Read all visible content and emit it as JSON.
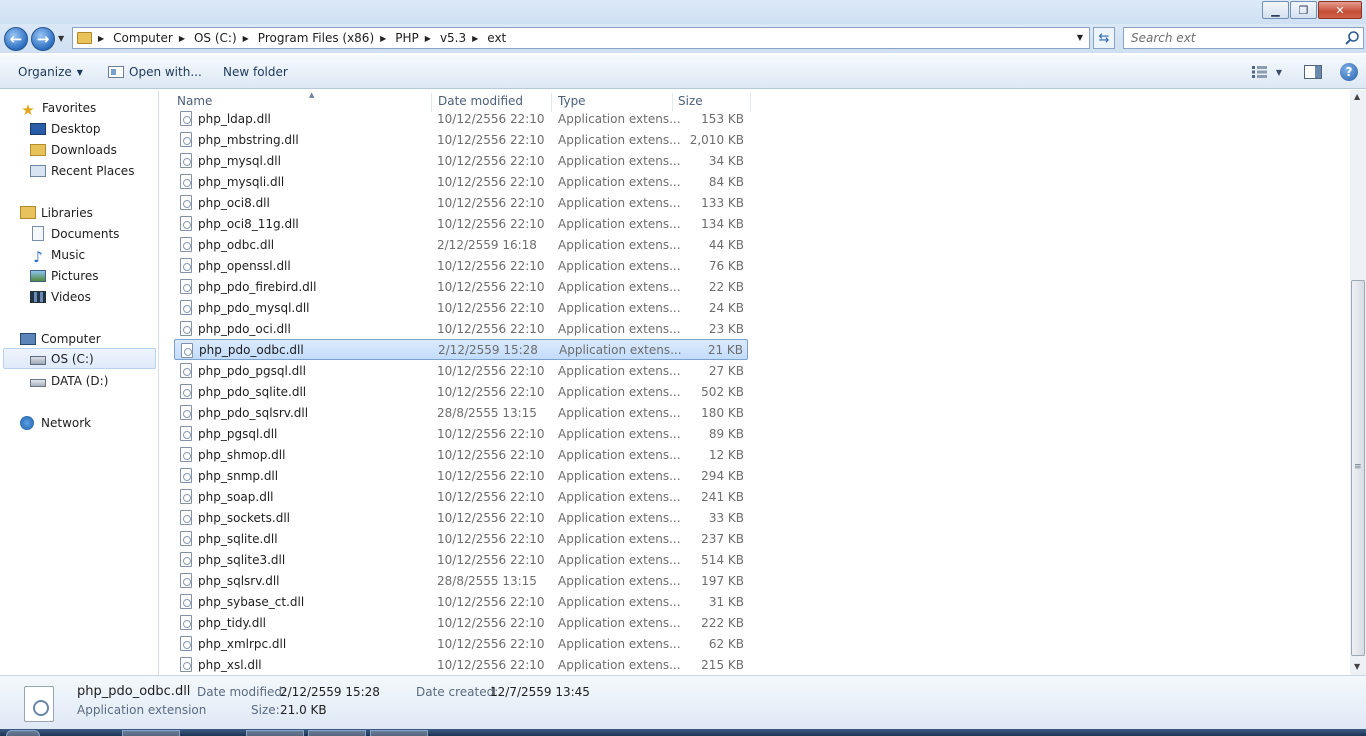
{
  "window": {
    "minimize_glyph": "▁",
    "restore_glyph": "❐",
    "close_glyph": "✕"
  },
  "nav": {
    "back_glyph": "←",
    "forward_glyph": "→",
    "breadcrumb": [
      "Computer",
      "OS (C:)",
      "Program Files (x86)",
      "PHP",
      "v5.3",
      "ext"
    ],
    "search_placeholder": "Search ext"
  },
  "toolbar": {
    "organize_label": "Organize",
    "open_with_label": "Open with...",
    "new_folder_label": "New folder",
    "help_glyph": "?"
  },
  "sidebar": {
    "favorites_label": "Favorites",
    "desktop_label": "Desktop",
    "downloads_label": "Downloads",
    "recent_label": "Recent Places",
    "libraries_label": "Libraries",
    "documents_label": "Documents",
    "music_label": "Music",
    "pictures_label": "Pictures",
    "videos_label": "Videos",
    "computer_label": "Computer",
    "drive_c_label": "OS (C:)",
    "drive_d_label": "DATA (D:)",
    "network_label": "Network"
  },
  "columns": {
    "name": "Name",
    "date": "Date modified",
    "type": "Type",
    "size": "Size"
  },
  "files": [
    {
      "name": "php_ldap.dll",
      "date": "10/12/2556 22:10",
      "type": "Application extens...",
      "size": "153 KB"
    },
    {
      "name": "php_mbstring.dll",
      "date": "10/12/2556 22:10",
      "type": "Application extens...",
      "size": "2,010 KB"
    },
    {
      "name": "php_mysql.dll",
      "date": "10/12/2556 22:10",
      "type": "Application extens...",
      "size": "34 KB"
    },
    {
      "name": "php_mysqli.dll",
      "date": "10/12/2556 22:10",
      "type": "Application extens...",
      "size": "84 KB"
    },
    {
      "name": "php_oci8.dll",
      "date": "10/12/2556 22:10",
      "type": "Application extens...",
      "size": "133 KB"
    },
    {
      "name": "php_oci8_11g.dll",
      "date": "10/12/2556 22:10",
      "type": "Application extens...",
      "size": "134 KB"
    },
    {
      "name": "php_odbc.dll",
      "date": "2/12/2559 16:18",
      "type": "Application extens...",
      "size": "44 KB"
    },
    {
      "name": "php_openssl.dll",
      "date": "10/12/2556 22:10",
      "type": "Application extens...",
      "size": "76 KB"
    },
    {
      "name": "php_pdo_firebird.dll",
      "date": "10/12/2556 22:10",
      "type": "Application extens...",
      "size": "22 KB"
    },
    {
      "name": "php_pdo_mysql.dll",
      "date": "10/12/2556 22:10",
      "type": "Application extens...",
      "size": "24 KB"
    },
    {
      "name": "php_pdo_oci.dll",
      "date": "10/12/2556 22:10",
      "type": "Application extens...",
      "size": "23 KB"
    },
    {
      "name": "php_pdo_odbc.dll",
      "date": "2/12/2559 15:28",
      "type": "Application extens...",
      "size": "21 KB",
      "selected": true
    },
    {
      "name": "php_pdo_pgsql.dll",
      "date": "10/12/2556 22:10",
      "type": "Application extens...",
      "size": "27 KB"
    },
    {
      "name": "php_pdo_sqlite.dll",
      "date": "10/12/2556 22:10",
      "type": "Application extens...",
      "size": "502 KB"
    },
    {
      "name": "php_pdo_sqlsrv.dll",
      "date": "28/8/2555 13:15",
      "type": "Application extens...",
      "size": "180 KB"
    },
    {
      "name": "php_pgsql.dll",
      "date": "10/12/2556 22:10",
      "type": "Application extens...",
      "size": "89 KB"
    },
    {
      "name": "php_shmop.dll",
      "date": "10/12/2556 22:10",
      "type": "Application extens...",
      "size": "12 KB"
    },
    {
      "name": "php_snmp.dll",
      "date": "10/12/2556 22:10",
      "type": "Application extens...",
      "size": "294 KB"
    },
    {
      "name": "php_soap.dll",
      "date": "10/12/2556 22:10",
      "type": "Application extens...",
      "size": "241 KB"
    },
    {
      "name": "php_sockets.dll",
      "date": "10/12/2556 22:10",
      "type": "Application extens...",
      "size": "33 KB"
    },
    {
      "name": "php_sqlite.dll",
      "date": "10/12/2556 22:10",
      "type": "Application extens...",
      "size": "237 KB"
    },
    {
      "name": "php_sqlite3.dll",
      "date": "10/12/2556 22:10",
      "type": "Application extens...",
      "size": "514 KB"
    },
    {
      "name": "php_sqlsrv.dll",
      "date": "28/8/2555 13:15",
      "type": "Application extens...",
      "size": "197 KB"
    },
    {
      "name": "php_sybase_ct.dll",
      "date": "10/12/2556 22:10",
      "type": "Application extens...",
      "size": "31 KB"
    },
    {
      "name": "php_tidy.dll",
      "date": "10/12/2556 22:10",
      "type": "Application extens...",
      "size": "222 KB"
    },
    {
      "name": "php_xmlrpc.dll",
      "date": "10/12/2556 22:10",
      "type": "Application extens...",
      "size": "62 KB"
    },
    {
      "name": "php_xsl.dll",
      "date": "10/12/2556 22:10",
      "type": "Application extens...",
      "size": "215 KB"
    }
  ],
  "details": {
    "file_name": "php_pdo_odbc.dll",
    "file_type": "Application extension",
    "modified_label": "Date modified:",
    "modified_value": "2/12/2559 15:28",
    "size_label": "Size:",
    "size_value": "21.0 KB",
    "created_label": "Date created:",
    "created_value": "12/7/2559 13:45"
  }
}
